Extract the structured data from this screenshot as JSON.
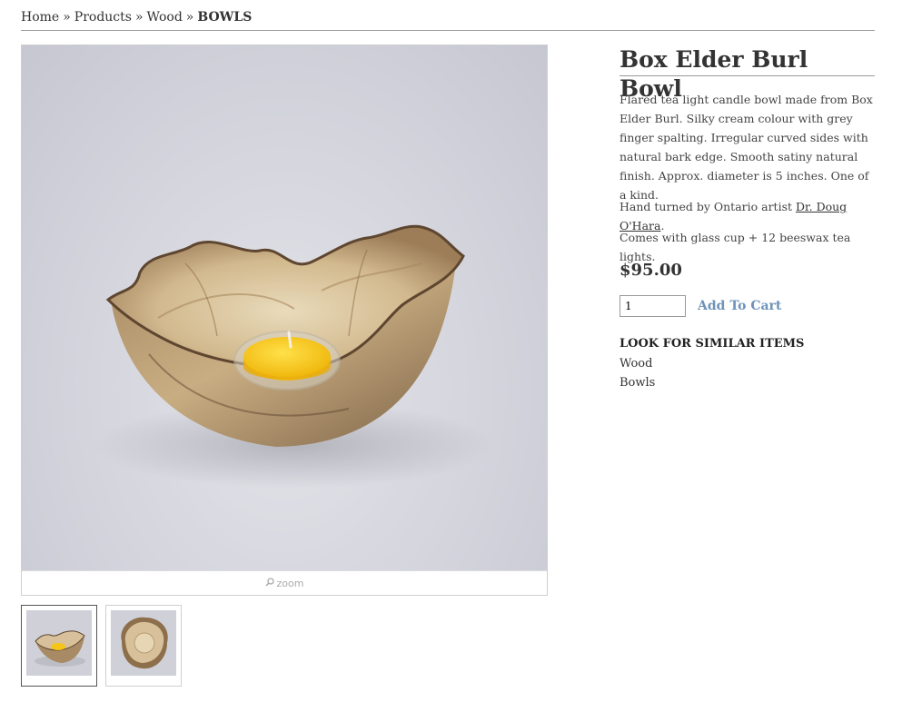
{
  "breadcrumb": {
    "items": [
      "Home",
      "Products",
      "Wood"
    ],
    "separator": "»",
    "current": "BOWLS"
  },
  "product": {
    "title": "Box Elder Burl Bowl",
    "description": "Flared tea light candle bowl made from Box Elder Burl. Silky cream colour with grey finger spalting. Irregular curved sides with natural bark edge. Smooth satiny natural finish. Approx. diameter is 5 inches. One of a kind.",
    "artist_prefix": "Hand turned by Ontario artist ",
    "artist_name": "Dr. Doug O'Hara",
    "artist_suffix": ".",
    "includes": "Comes with glass cup + 12 beeswax tea lights.",
    "price": "$95.00",
    "quantity": "1",
    "add_to_cart_label": "Add To Cart"
  },
  "gallery": {
    "zoom_label": "zoom",
    "zoom_icon": "magnifier-icon",
    "thumbnail_count": 2,
    "active_thumbnail": 0
  },
  "similar": {
    "title": "LOOK FOR SIMILAR ITEMS",
    "items": [
      "Wood",
      "Bowls"
    ]
  },
  "colors": {
    "link_accent": "#6e93b9",
    "text": "#333333",
    "tea_light_wax": "#f5c518"
  }
}
